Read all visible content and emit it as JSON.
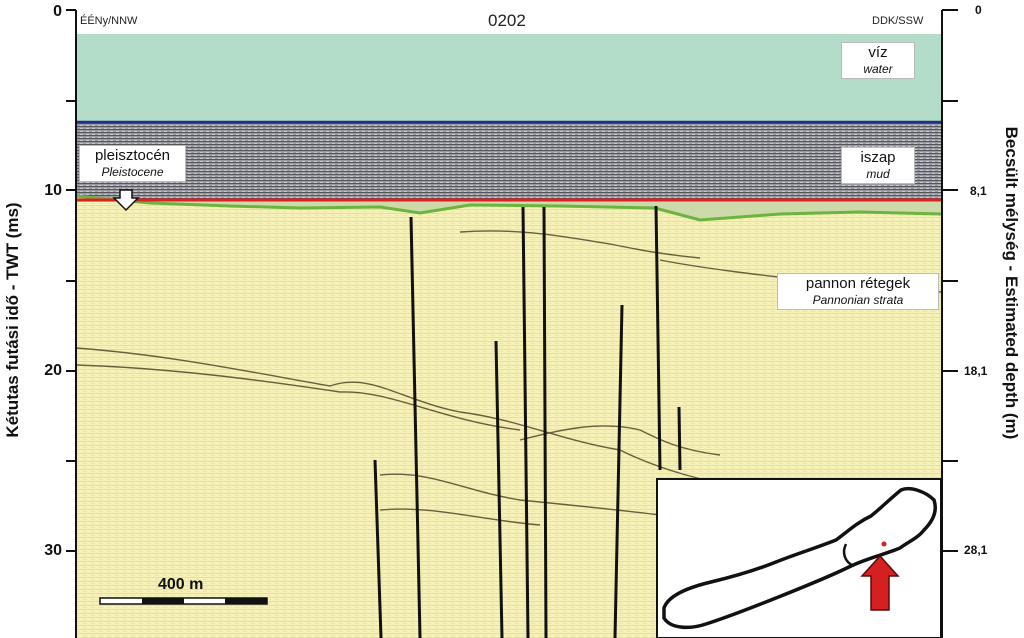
{
  "profile_id": "0202",
  "direction": {
    "left": "ÉÉNy/NNW",
    "right": "DDK/SSW"
  },
  "left_axis": {
    "title": "Kétutas futási idő - TWT (ms)",
    "ticks": [
      "0",
      "10",
      "20",
      "30"
    ]
  },
  "right_axis": {
    "title": "Becsült mélység - Estimated depth (m)",
    "ticks": [
      "0",
      "8,1",
      "18,1",
      "28,1"
    ]
  },
  "layers": {
    "water": {
      "hu": "víz",
      "en": "water",
      "color": "#b3ddc9"
    },
    "mud": {
      "hu": "iszap",
      "en": "mud",
      "color": "#8e8e96"
    },
    "pleistocene": {
      "hu": "pleisztocén",
      "en": "Pleistocene",
      "color": "#6db33f"
    },
    "pannonian": {
      "hu": "pannon rétegek",
      "en": "Pannonian strata",
      "color": "#f6f2b8"
    }
  },
  "boundary_colors": {
    "water_mud": "#1e2f8c",
    "mud_base": "#e02020"
  },
  "scale_bar": {
    "label": "400 m"
  },
  "inset_map": {
    "marker_color": "#d42020"
  }
}
